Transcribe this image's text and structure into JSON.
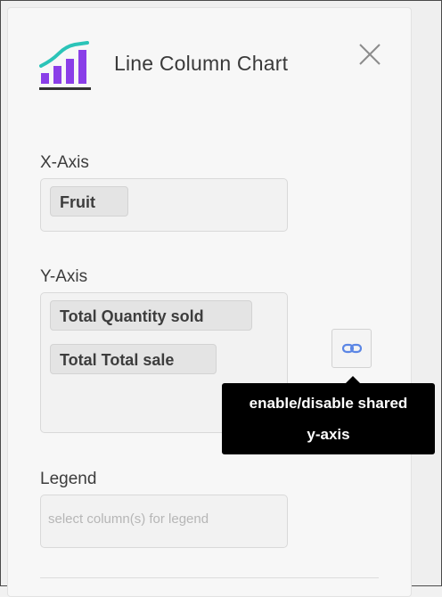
{
  "panel": {
    "title": "Line Column Chart",
    "chart_icon": "line-column-chart-icon",
    "close_icon": "close-icon"
  },
  "x_axis": {
    "label": "X-Axis",
    "chips": [
      "Fruit"
    ]
  },
  "y_axis": {
    "label": "Y-Axis",
    "chips": [
      "Total Quantity sold",
      "Total Total sale"
    ],
    "link_icon": "link-icon"
  },
  "tooltip": {
    "line1": "enable/disable shared",
    "line2": "y-axis"
  },
  "legend": {
    "label": "Legend",
    "placeholder": "select column(s) for legend"
  },
  "colors": {
    "icon_purple": "#8a3ee8",
    "icon_teal": "#2bc4b8",
    "link_blue": "#5b86e5",
    "tooltip_bg": "#000000"
  }
}
